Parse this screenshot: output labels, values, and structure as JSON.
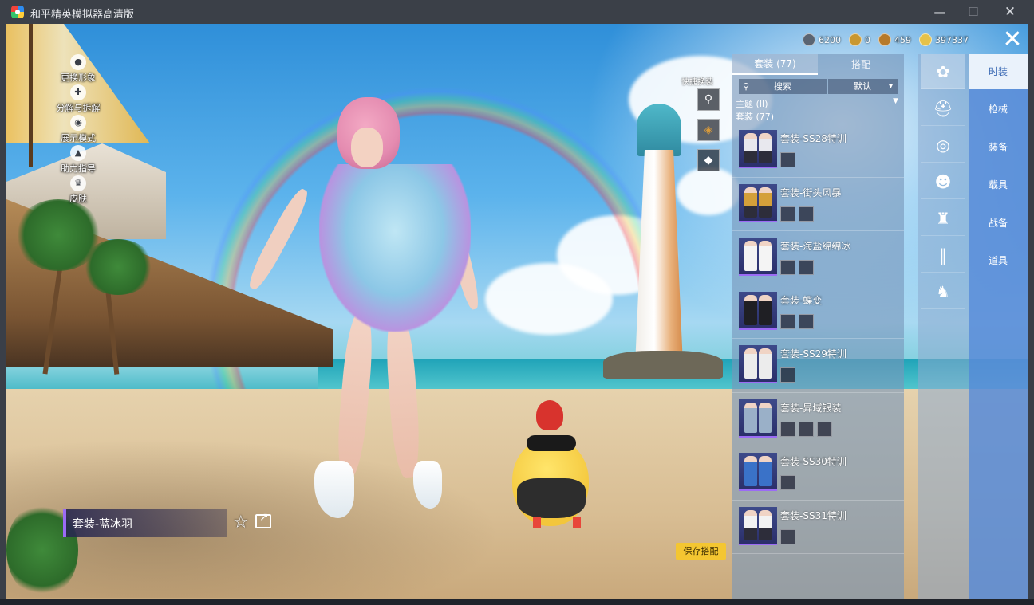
{
  "window": {
    "title": "和平精英模拟器高清版",
    "minimize": "—",
    "maximize": "☐",
    "close": "✕"
  },
  "left_menu": [
    {
      "label": "更换形象",
      "icon": "person-icon",
      "glyph": "●"
    },
    {
      "label": "分解与拆解",
      "icon": "disassemble-icon",
      "glyph": "✚"
    },
    {
      "label": "展示模式",
      "icon": "eye-icon",
      "glyph": "◉"
    },
    {
      "label": "助力指导",
      "icon": "flame-icon",
      "glyph": "▲"
    },
    {
      "label": "皮肤",
      "icon": "crown-icon",
      "glyph": "♛"
    }
  ],
  "currency": [
    {
      "value": "6200",
      "color": "#5a6472"
    },
    {
      "value": "0",
      "color": "#c9972f"
    },
    {
      "value": "459",
      "color": "#b77a2a"
    },
    {
      "value": "397337",
      "color": "#e6c24a"
    }
  ],
  "viewport_close": "✕",
  "quick_dress": {
    "label": "快捷换装",
    "slots": [
      "⚲",
      "◈",
      "◆"
    ]
  },
  "list_panel": {
    "tabs": [
      {
        "label": "套装 (77)"
      },
      {
        "label": "搭配"
      }
    ],
    "search_placeholder": "搜索",
    "sort_value": "默认",
    "theme_label": "主题 (II)",
    "suit_count": "套装 (77)",
    "outfits": [
      {
        "name": "套装-SS28特训",
        "parts": 1
      },
      {
        "name": "套装-街头风暴",
        "parts": 2
      },
      {
        "name": "套装-海盐绵绵冰",
        "parts": 2
      },
      {
        "name": "套装-蝶变",
        "parts": 2
      },
      {
        "name": "套装-SS29特训",
        "parts": 1
      },
      {
        "name": "套装-异域银装",
        "parts": 3
      },
      {
        "name": "套装-SS30特训",
        "parts": 1
      },
      {
        "name": "套装-SS31特训",
        "parts": 1
      }
    ]
  },
  "category_icons": [
    {
      "icon": "outfit-icon",
      "glyph": "✿",
      "active": true
    },
    {
      "icon": "hat-icon",
      "glyph": "⛑"
    },
    {
      "icon": "glasses-icon",
      "glyph": "◎"
    },
    {
      "icon": "mask-icon",
      "glyph": "☻"
    },
    {
      "icon": "top-icon",
      "glyph": "♜"
    },
    {
      "icon": "pants-icon",
      "glyph": "‖"
    },
    {
      "icon": "shoes-icon",
      "glyph": "♞"
    }
  ],
  "category_tabs": [
    {
      "label": "时装",
      "active": true
    },
    {
      "label": "枪械"
    },
    {
      "label": "装备"
    },
    {
      "label": "载具"
    },
    {
      "label": "战备"
    },
    {
      "label": "道具"
    }
  ],
  "current_suit": {
    "name": "套装-蓝冰羽"
  },
  "favorite_glyph": "☆",
  "save_button": "保存搭配"
}
